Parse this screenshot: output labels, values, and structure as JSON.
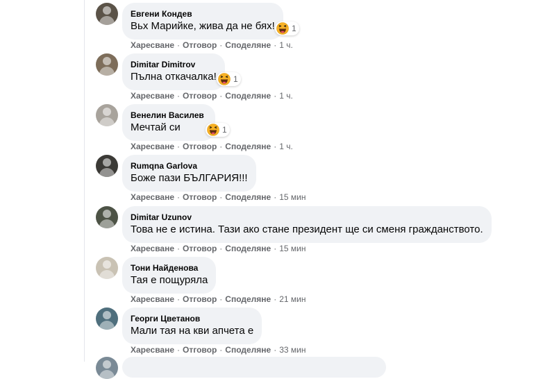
{
  "action_labels": {
    "like": "Харесване",
    "reply": "Отговор",
    "share": "Споделяне",
    "separator": "·"
  },
  "comments": [
    {
      "author": "Евгени Кондев",
      "text": "Вьх Марийке, жива да не бях!",
      "time": "1 ч.",
      "reaction_count": "1",
      "reaction_icon": "haha-emoji-icon",
      "avatar_color": "#5b5348"
    },
    {
      "author": "Dimitar Dimitrov",
      "text": "Пълна откачалка!",
      "time": "1 ч.",
      "reaction_count": "1",
      "reaction_icon": "haha-emoji-icon",
      "avatar_color": "#7d6d5a"
    },
    {
      "author": "Венелин Василев",
      "text": "Мечтай си",
      "time": "1 ч.",
      "reaction_count": "1",
      "reaction_icon": "haha-emoji-icon",
      "avatar_color": "#a8a39c"
    },
    {
      "author": "Rumqna Garlova",
      "text": "Боже пази БЪЛГАРИЯ!!!",
      "time": "15 мин",
      "reaction_count": null,
      "avatar_color": "#3b3a36"
    },
    {
      "author": "Dimitar Uzunov",
      "text": "Това не е истина. Тази ако стане президент ще си сменя гражданството.",
      "time": "15 мин",
      "reaction_count": null,
      "avatar_color": "#4d5346"
    },
    {
      "author": "Тони Найденова",
      "text": "Тая е пощуряла",
      "time": "21 мин",
      "reaction_count": null,
      "avatar_color": "#c9c2b4"
    },
    {
      "author": "Георги Цветанов",
      "text": "Мали тая на кви апчета е",
      "time": "33 мин",
      "reaction_count": null,
      "avatar_color": "#4f6f7d"
    }
  ],
  "colors": {
    "bubble": "#f0f2f5",
    "meta_text": "#65676b",
    "body_text": "#050505",
    "haha": "#f7b125"
  }
}
